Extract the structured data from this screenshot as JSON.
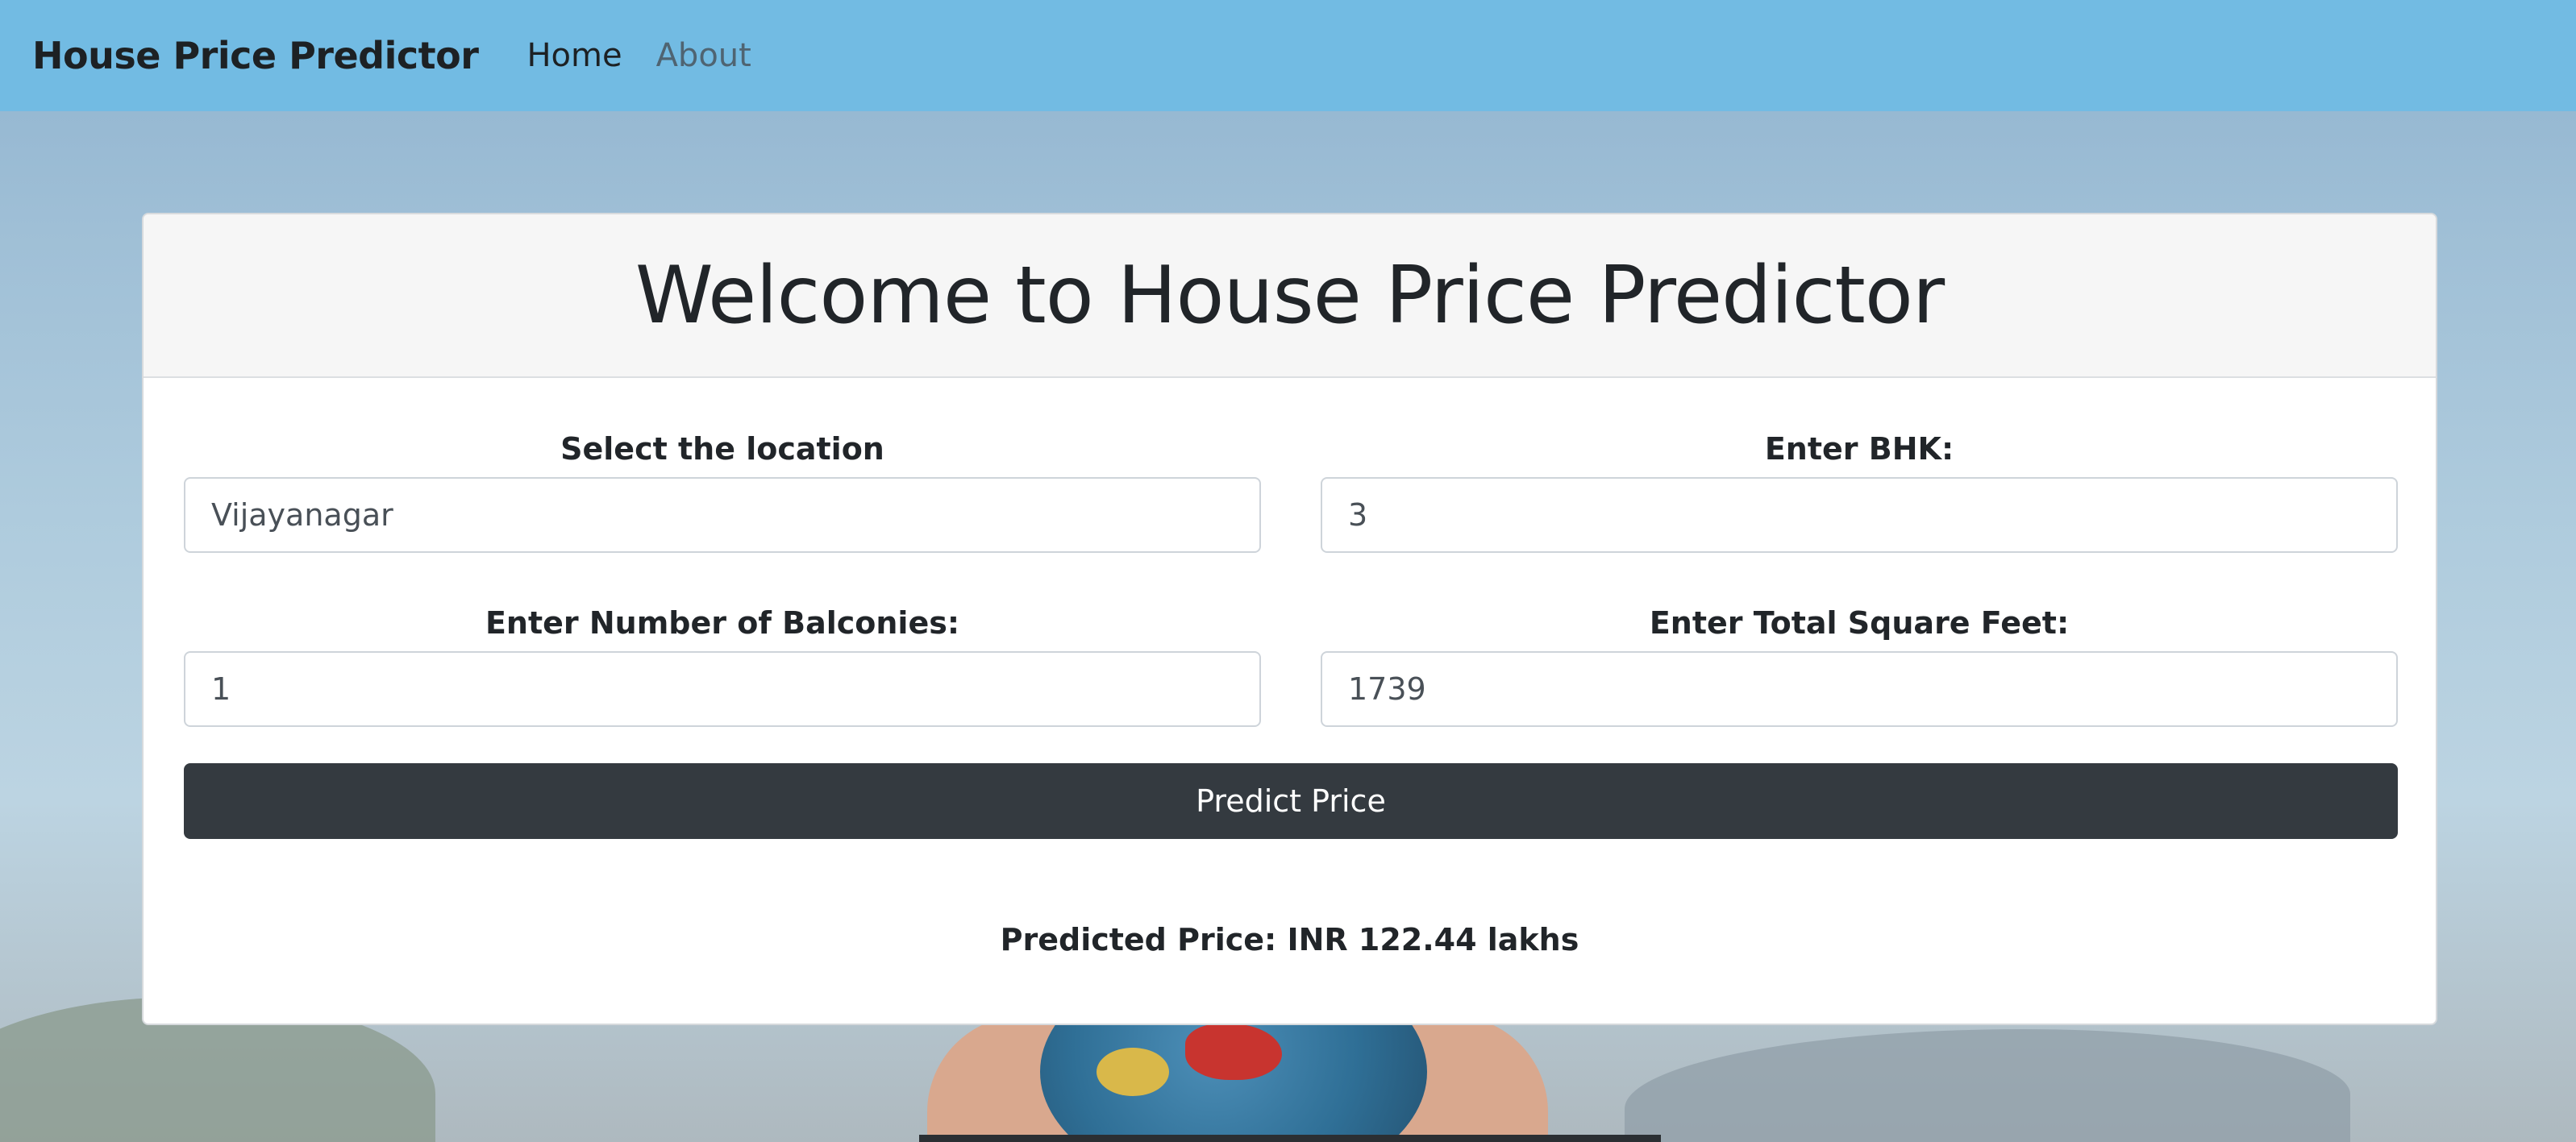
{
  "navbar": {
    "brand": "House Price Predictor",
    "links": [
      {
        "label": "Home"
      },
      {
        "label": "About"
      }
    ]
  },
  "card": {
    "title": "Welcome to House Price Predictor"
  },
  "form": {
    "location": {
      "label": "Select the location",
      "value": "Vijayanagar"
    },
    "bhk": {
      "label": "Enter BHK:",
      "value": "3"
    },
    "balconies": {
      "label": "Enter Number of Balconies:",
      "value": "1"
    },
    "sqft": {
      "label": "Enter Total Square Feet:",
      "value": "1739"
    },
    "submit_label": "Predict Price"
  },
  "result": {
    "text": "Predicted Price: INR 122.44 lakhs"
  },
  "colors": {
    "navbar": "#72bbe3",
    "button": "#343a40"
  }
}
